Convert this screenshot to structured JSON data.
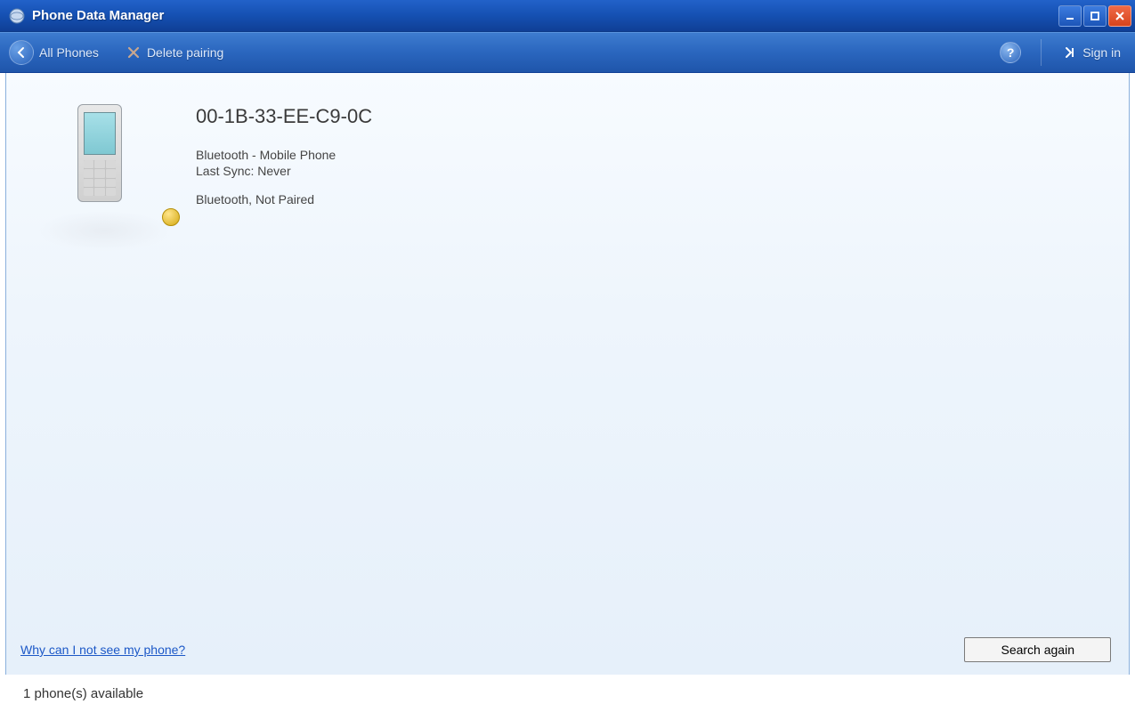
{
  "window": {
    "title": "Phone Data Manager"
  },
  "toolbar": {
    "all_phones_label": "All Phones",
    "delete_pairing_label": "Delete pairing",
    "signin_label": "Sign in"
  },
  "device": {
    "name": "00-1B-33-EE-C9-0C",
    "type_line": "Bluetooth - Mobile Phone",
    "last_sync_line": "Last Sync: Never",
    "status_line": "Bluetooth, Not Paired"
  },
  "footer": {
    "help_link_label": "Why can I not see my phone?",
    "search_button_label": "Search again"
  },
  "statusbar": {
    "text": "1 phone(s) available"
  }
}
